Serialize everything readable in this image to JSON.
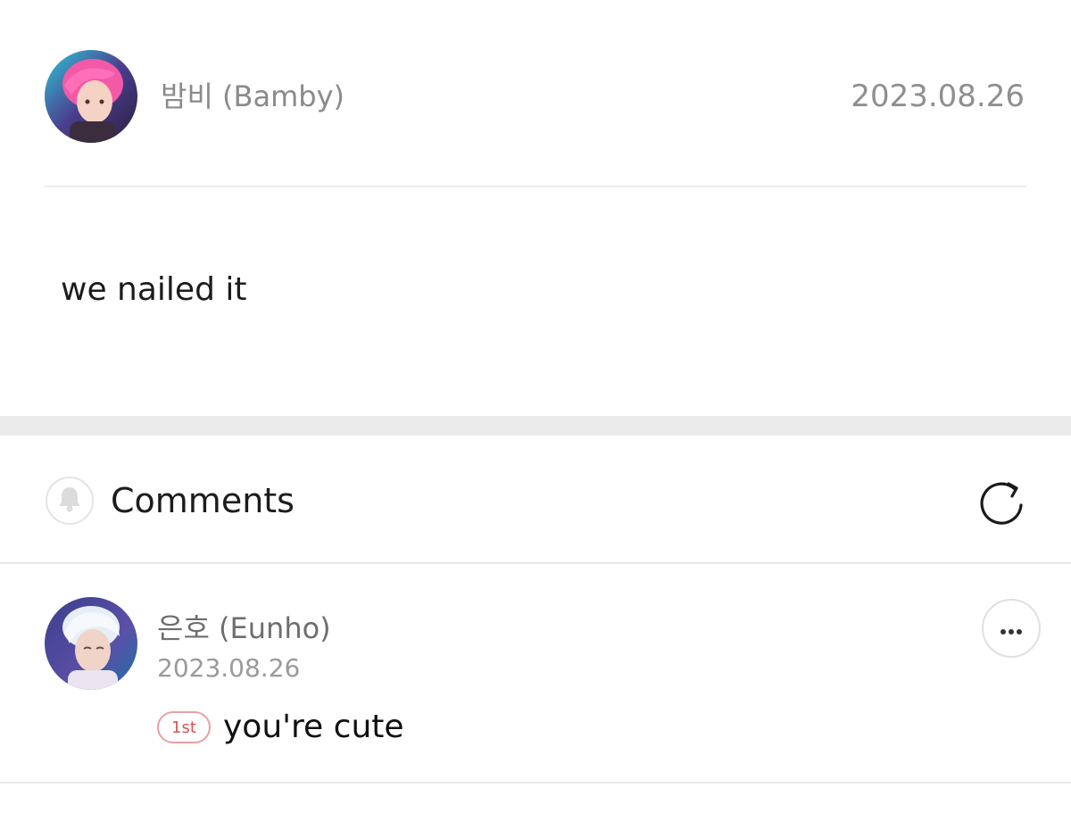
{
  "post": {
    "author": "밤비 (Bamby)",
    "date": "2023.08.26",
    "body": "we nailed it"
  },
  "comments_section": {
    "title": "Comments",
    "bell_icon": "bell-icon",
    "refresh_icon": "refresh-icon"
  },
  "comments": [
    {
      "author": "은호 (Eunho)",
      "date": "2023.08.26",
      "badge": "1st",
      "text": "you're cute",
      "more_icon": "more-options-icon"
    }
  ],
  "colors": {
    "badge_accent": "#d9534f",
    "muted_text": "#8a8a8a",
    "section_gap": "#ebebeb"
  }
}
